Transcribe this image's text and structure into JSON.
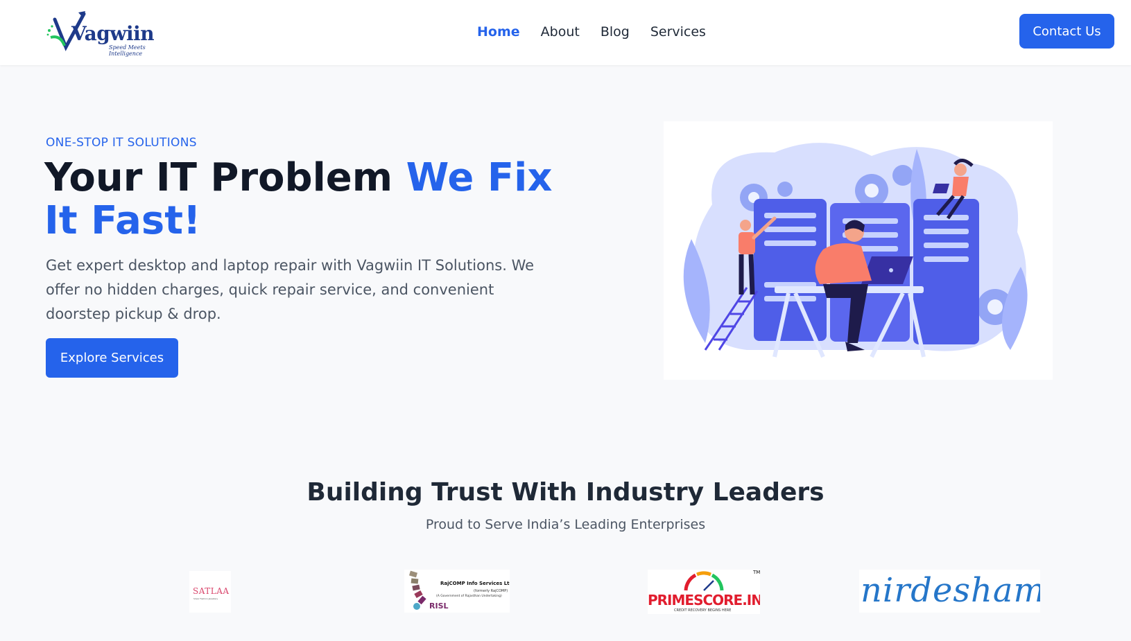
{
  "header": {
    "logo": {
      "brand": "Vagwiin",
      "tagline": "Speed Meets Intelligence"
    },
    "nav": [
      {
        "label": "Home",
        "active": true
      },
      {
        "label": "About",
        "active": false
      },
      {
        "label": "Blog",
        "active": false
      },
      {
        "label": "Services",
        "active": false
      }
    ],
    "contact_label": "Contact Us"
  },
  "hero": {
    "eyebrow": "ONE-STOP IT SOLUTIONS",
    "title_plain": "Your IT Problem ",
    "title_accent": "We Fix It Fast!",
    "description": "Get expert desktop and laptop repair with Vagwiin IT Solutions. We offer no hidden charges, quick repair service, and convenient doorstep pickup & drop.",
    "cta_label": "Explore Services"
  },
  "trust": {
    "title": "Building Trust With Industry Leaders",
    "subtitle": "Proud to Serve India’s Leading Enterprises",
    "partners": [
      {
        "name": "SATLAA",
        "tagline": "Silver Fashion Jewellery"
      },
      {
        "name": "RajCOMP Info Services Ltd",
        "line2": "(formerly RajCOMP)",
        "line3": "(A Government of Rajasthan Undertaking)",
        "short": "RISL"
      },
      {
        "name": "PRIMESCORE.IN",
        "tm": "TM",
        "tagline": "CREDIT RECOVERY BEGINS HERE"
      },
      {
        "name": "nirdesham"
      }
    ]
  },
  "colors": {
    "accent": "#2563eb",
    "heading": "#111827",
    "body_text": "#4b5563",
    "background": "#f8f9fb"
  }
}
